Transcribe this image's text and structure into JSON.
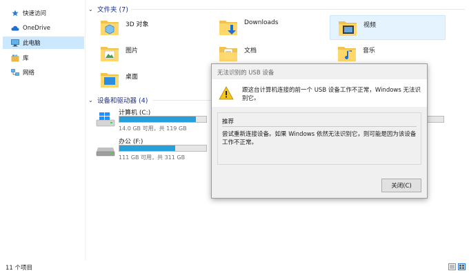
{
  "sidebar": {
    "items": [
      {
        "label": "快速访问",
        "icon": "star-icon"
      },
      {
        "label": "OneDrive",
        "icon": "cloud-icon"
      },
      {
        "label": "此电脑",
        "icon": "computer-icon",
        "selected": true
      },
      {
        "label": "库",
        "icon": "library-icon"
      },
      {
        "label": "网络",
        "icon": "network-icon"
      }
    ]
  },
  "folders_group": {
    "label": "文件夹 (7)",
    "items": [
      {
        "label": "3D 对象",
        "icon": "3d-objects-folder-icon"
      },
      {
        "label": "Downloads",
        "icon": "downloads-folder-icon"
      },
      {
        "label": "视频",
        "icon": "videos-folder-icon",
        "selected": true
      },
      {
        "label": "图片",
        "icon": "pictures-folder-icon"
      },
      {
        "label": "文档",
        "icon": "documents-folder-icon"
      },
      {
        "label": "音乐",
        "icon": "music-folder-icon"
      },
      {
        "label": "桌面",
        "icon": "desktop-folder-icon"
      }
    ]
  },
  "drives_group": {
    "label": "设备和驱动器 (4)",
    "items": [
      {
        "label": "计算机 (C:)",
        "free_text": "14.0 GB 可用，共 119 GB",
        "used_fraction": 0.88,
        "icon": "windows-drive-icon"
      },
      {
        "label": "办公 (F:)",
        "free_text": "111 GB 可用，共 311 GB",
        "used_fraction": 0.64,
        "icon": "hard-drive-icon"
      }
    ]
  },
  "status": {
    "item_count": "11 个项目"
  },
  "dialog": {
    "title": "无法识别的 USB 设备",
    "message": "跟这台计算机连接的前一个 USB 设备工作不正常，Windows 无法识别它。",
    "recommendation_heading": "推荐",
    "recommendation_text": "尝试重新连接设备。如果 Windows 依然无法识别它，则可能是因为该设备工作不正常。",
    "close_label": "关闭(C)"
  },
  "colors": {
    "accent": "#26a0da",
    "selection": "#cce8ff",
    "header_text": "#1e3287"
  }
}
